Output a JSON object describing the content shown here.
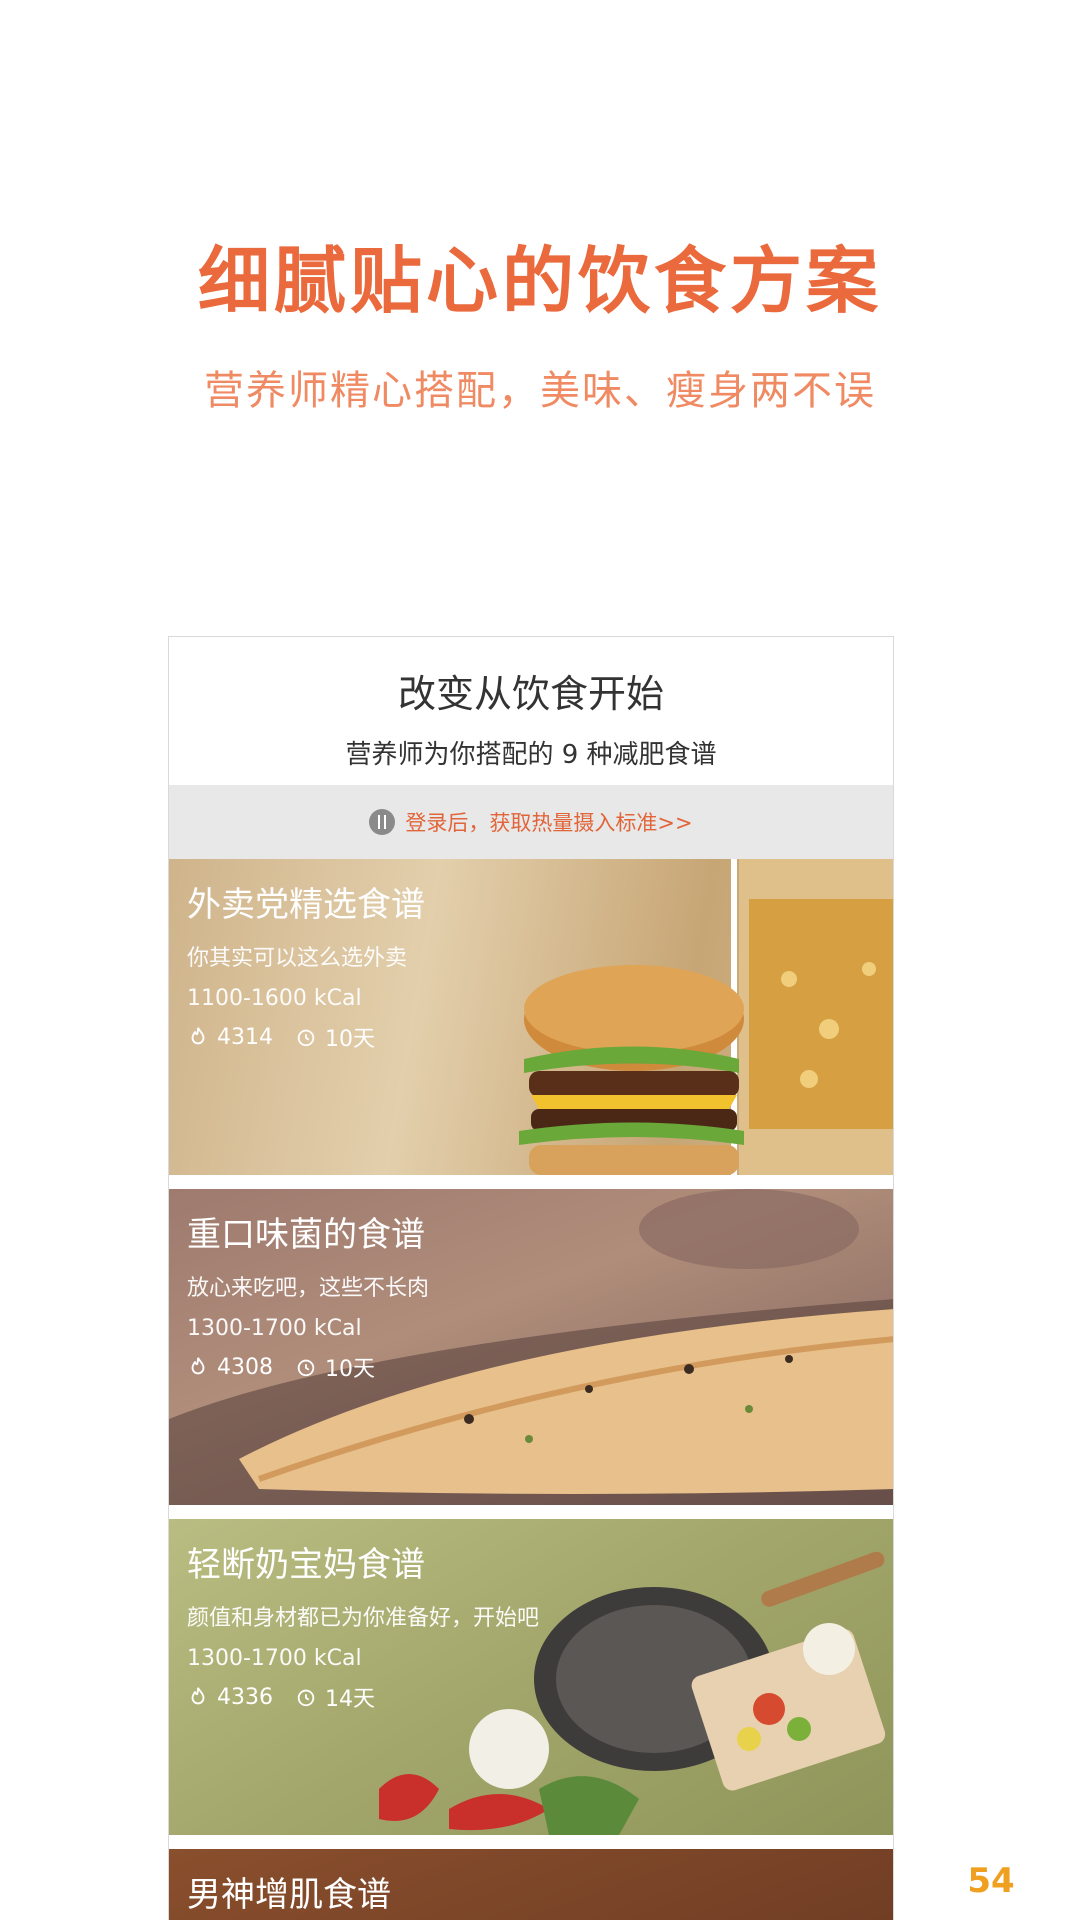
{
  "hero": {
    "title": "细腻贴心的饮食方案",
    "subtitle": "营养师精心搭配，美味、瘦身两不误"
  },
  "frame": {
    "title": "改变从饮食开始",
    "subtitle": "营养师为你搭配的 9 种减肥食谱",
    "login_banner": "登录后，获取热量摄入标准>>"
  },
  "recipes": [
    {
      "title": "外卖党精选食谱",
      "desc": "你其实可以这么选外卖",
      "kcal": "1100-1600 kCal",
      "users": "4314",
      "days": "10天"
    },
    {
      "title": "重口味菌的食谱",
      "desc": "放心来吃吧，这些不长肉",
      "kcal": "1300-1700 kCal",
      "users": "4308",
      "days": "10天"
    },
    {
      "title": "轻断奶宝妈食谱",
      "desc": "颜值和身材都已为你准备好，开始吧",
      "kcal": "1300-1700 kCal",
      "users": "4336",
      "days": "14天"
    },
    {
      "title": "男神增肌食谱"
    }
  ],
  "watermark": {
    "text": "54"
  },
  "colors": {
    "accent": "#ea6a3d",
    "banner_text": "#e2653a"
  }
}
